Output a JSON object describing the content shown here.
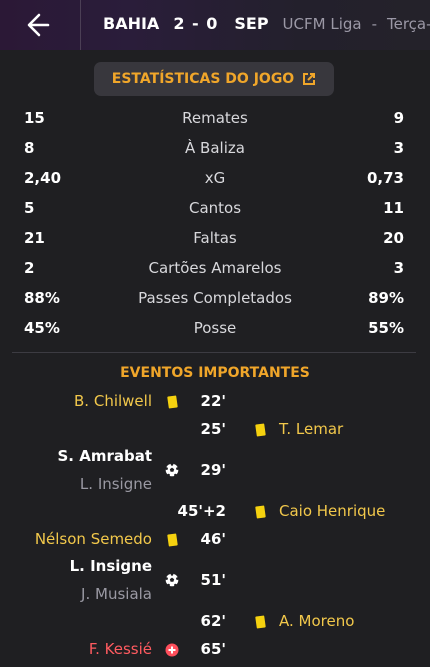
{
  "header": {
    "home": "BAHIA",
    "score": "2 - 0",
    "away": "SEP",
    "league": "UCFM Liga",
    "separator": "-",
    "date_partial": "Terça-f"
  },
  "stats_button": {
    "label": "ESTATÍSTICAS DO JOGO",
    "icon": "external-link-icon"
  },
  "stats": [
    {
      "label": "Remates",
      "home": "15",
      "away": "9"
    },
    {
      "label": "À Baliza",
      "home": "8",
      "away": "3"
    },
    {
      "label": "xG",
      "home": "2,40",
      "away": "0,73"
    },
    {
      "label": "Cantos",
      "home": "5",
      "away": "11"
    },
    {
      "label": "Faltas",
      "home": "21",
      "away": "20"
    },
    {
      "label": "Cartões Amarelos",
      "home": "2",
      "away": "3"
    },
    {
      "label": "Passes Completados",
      "home": "88%",
      "away": "89%"
    },
    {
      "label": "Posse",
      "home": "45%",
      "away": "55%"
    }
  ],
  "events_title": "EVENTOS IMPORTANTES",
  "events": [
    {
      "player": "B. Chilwell",
      "minute": "22'",
      "type": "yellow-card-icon"
    },
    {
      "player": "T. Lemar",
      "minute": "25'",
      "type": "yellow-card-icon"
    },
    {
      "player": "S. Amrabat",
      "assist": "L. Insigne",
      "minute": "29'",
      "type": "goal-ball-icon"
    },
    {
      "player": "Caio Henrique",
      "minute": "45'+2",
      "type": "yellow-card-icon"
    },
    {
      "player": "Nélson Semedo",
      "minute": "46'",
      "type": "yellow-card-icon"
    },
    {
      "player": "L. Insigne",
      "assist": "J. Musiala",
      "minute": "51'",
      "type": "goal-ball-icon"
    },
    {
      "player": "A. Moreno",
      "minute": "62'",
      "type": "yellow-card-icon"
    },
    {
      "player": "F. Kessié",
      "minute": "65'",
      "type": "injury-icon"
    }
  ],
  "colors": {
    "accent": "#f0a62a",
    "yellow_name": "#f2c84b",
    "red_name": "#ff5b60",
    "background": "#1f1f22"
  }
}
